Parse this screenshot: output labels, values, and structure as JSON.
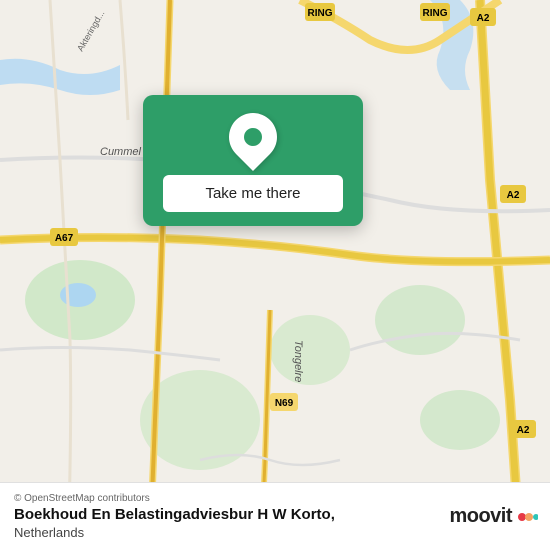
{
  "map": {
    "background_color": "#f2efe9",
    "alt": "Street map showing Netherlands area"
  },
  "popup": {
    "button_label": "Take me there",
    "background_color": "#2e9e68"
  },
  "info_bar": {
    "copyright": "© OpenStreetMap contributors",
    "title": "Boekhoud En Belastingadviesbur H W Korto,",
    "subtitle": "Netherlands"
  },
  "moovit": {
    "logo_text": "moovit",
    "dot_colors": [
      "#e63946",
      "#f4a261",
      "#2ec4b6"
    ]
  }
}
